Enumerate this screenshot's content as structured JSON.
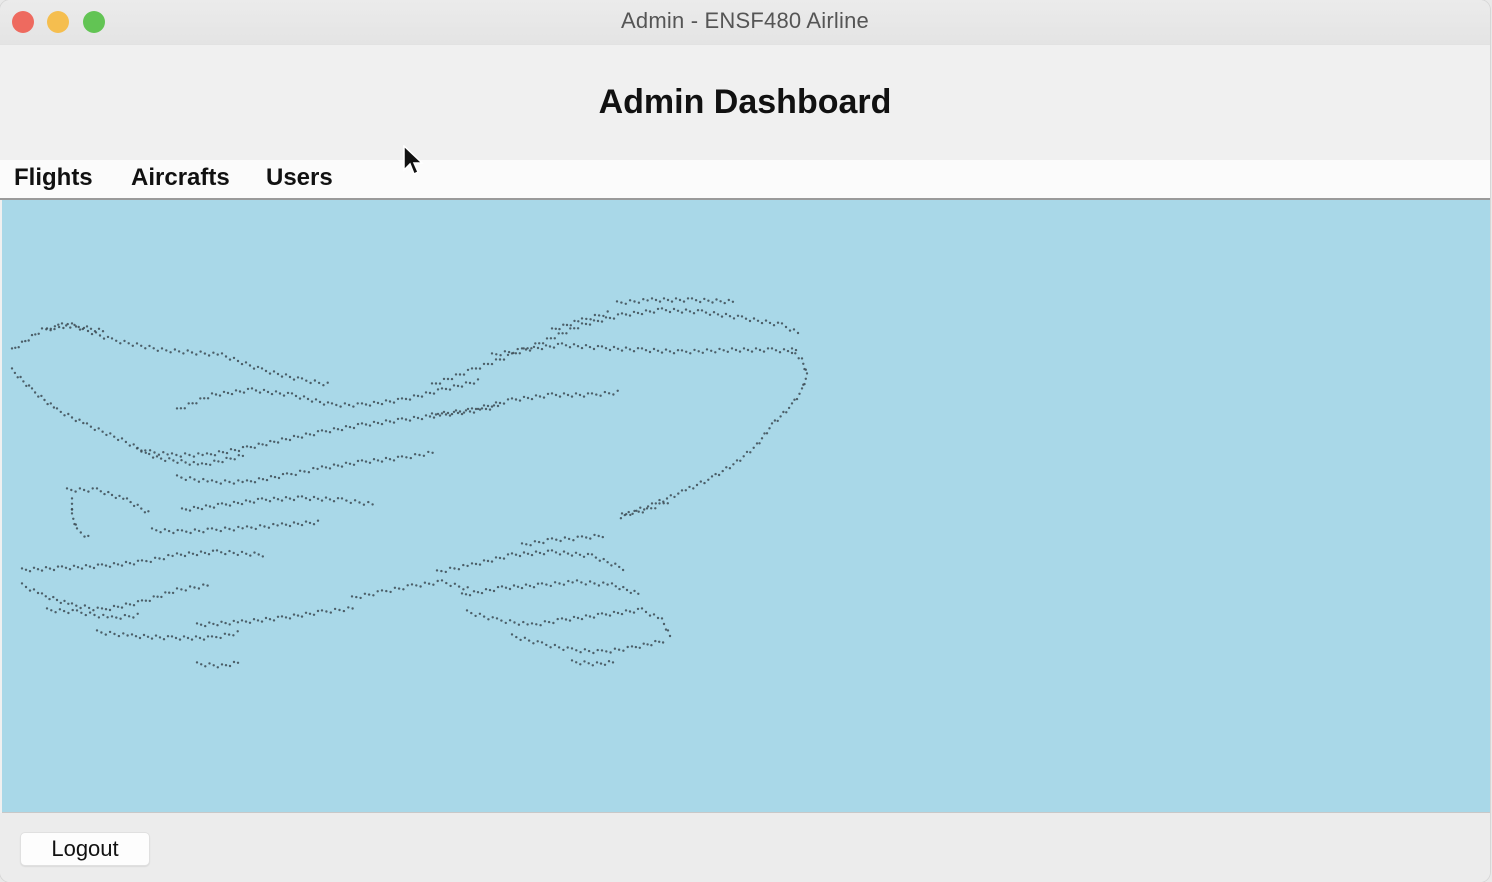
{
  "window": {
    "title": "Admin - ENSF480 Airline",
    "controls": [
      "close",
      "minimize",
      "zoom"
    ]
  },
  "header": {
    "title": "Admin Dashboard"
  },
  "menu": {
    "items": [
      {
        "label": "Flights"
      },
      {
        "label": "Aircrafts"
      },
      {
        "label": "Users"
      }
    ]
  },
  "content": {
    "background": "#a9d8e8",
    "art": "airplane-braille-art"
  },
  "footer": {
    "logout_label": "Logout"
  },
  "colors": {
    "close": "#ee6a5f",
    "minimize": "#f5be4f",
    "zoom": "#62c454"
  }
}
